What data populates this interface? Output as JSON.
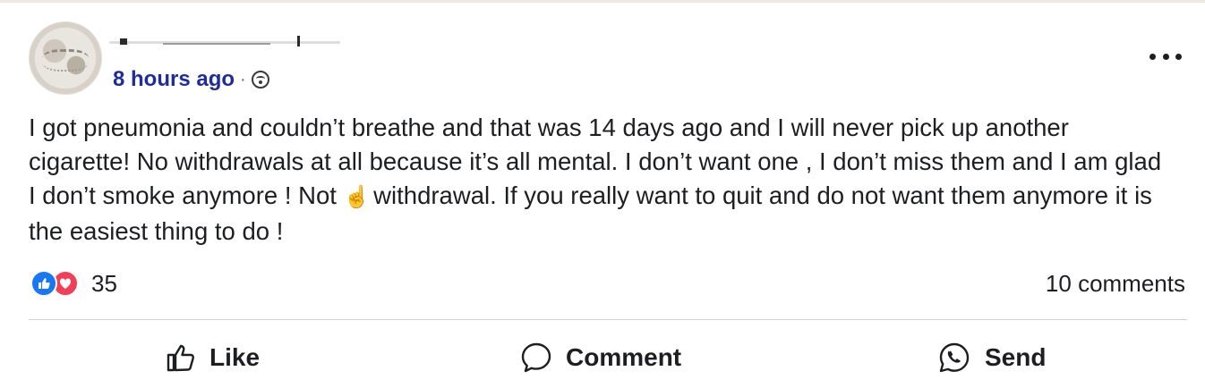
{
  "post": {
    "time": "8 hours ago",
    "separator": "·",
    "privacy_icon": "friends-icon",
    "more_icon": "more-horizontal-icon",
    "text_parts": [
      "I got pneumonia and couldn’t breathe and that was 14 days ago and I will never pick up another cigarette! No withdrawals at all because it’s all mental. I don’t want one , I don’t miss them and I am glad I don’t smoke anymore ! Not ",
      "☝",
      " withdrawal. If you really want to quit and do not want them anymore it is the easiest thing to do !"
    ]
  },
  "stats": {
    "reaction_count": "35",
    "comments": "10 comments",
    "reaction_icons": [
      "like-reaction-icon",
      "love-reaction-icon"
    ]
  },
  "actions": {
    "like": "Like",
    "comment": "Comment",
    "send": "Send"
  },
  "colors": {
    "link_blue": "#1f2c9c",
    "like_blue": "#1877f2",
    "love_red": "#f33e58"
  }
}
